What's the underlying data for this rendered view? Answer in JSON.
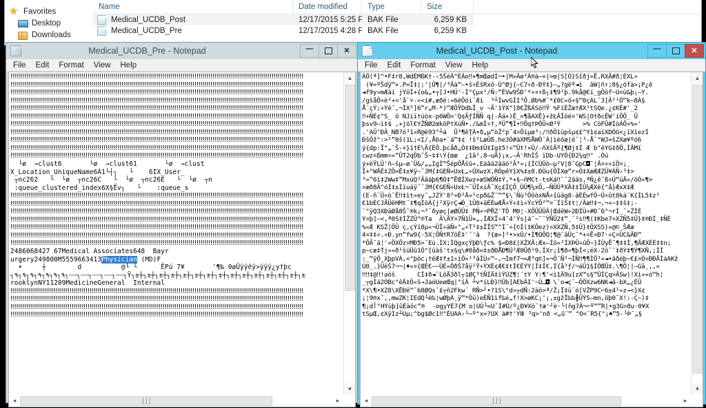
{
  "explorer": {
    "nav": {
      "items": [
        {
          "label": "Favorites",
          "icon": "star-icon"
        },
        {
          "label": "Desktop",
          "icon": "desktop-icon"
        },
        {
          "label": "Downloads",
          "icon": "download-icon"
        }
      ]
    },
    "columns": [
      "Name",
      "Date modified",
      "Type",
      "Size"
    ],
    "rows": [
      {
        "name": "Medical_UCDB_Post",
        "date": "12/17/2015 5:25 PM",
        "type": "BAK File",
        "size": "6,259 KB",
        "selected": true
      },
      {
        "name": "Medical_UCDB_Pre",
        "date": "12/17/2015 4:28 PM",
        "type": "BAK File",
        "size": "6,259 KB",
        "selected": false
      }
    ]
  },
  "notepad_left": {
    "title": "Medical_UCDB_Pre - Notepad",
    "app_icon": "notepad-icon",
    "menu": [
      "File",
      "Edit",
      "Format",
      "View",
      "Help"
    ],
    "window_buttons": {
      "minimize": "minimize-button",
      "maximize": "maximize-button",
      "close": "close-button"
    },
    "active": false,
    "selection_text": "Physician",
    "content_before": "‼‼‼‼‼‼‼‼‼‼‼‼‼‼‼‼‼‼‼‼‼‼‼‼‼‼‼‼‼‼‼‼‼‼‼‼‼‼‼‼‼‼‼‼‼‼‼‼‼‼‼‼‼‼‼‼‼‼‼‼‼‼‼‼‼‼‼‼‼‼‼‼‼‼\n‼‼‼‼‼‼‼‼‼‼‼‼‼‼‼‼‼‼‼‼‼‼‼‼‼‼‼‼‼‼‼‼‼‼‼‼‼‼‼‼‼‼‼‼‼‼‼‼‼‼‼‼‼‼‼‼‼‼‼‼‼‼‼‼‼‼‼‼‼‼‼‼‼‼\n‼‼‼‼‼‼‼‼‼‼‼‼‼‼‼‼‼‼‼‼‼‼‼‼‼‼‼‼‼‼‼‼‼‼‼‼‼‼‼‼‼‼‼‼‼‼‼‼‼‼‼‼‼‼‼‼‼‼‼‼‼‼‼‼‼‼‼‼‼‼‼‼‼‼\n‼‼‼‼‼‼‼‼‼‼‼‼‼‼‼‼‼‼‼‼‼‼‼‼‼‼‼‼‼‼‼‼‼‼‼‼‼‼‼‼‼‼‼‼‼‼‼‼‼‼‼‼‼‼‼‼‼‼‼‼‼‼‼‼‼‼‼‼‼‼‼‼‼‼\n‼‼‼‼‼‼‼‼‼‼‼‼‼‼‼‼‼‼‼‼‼‼‼‼‼‼‼‼‼‼‼‼‼‼‼‼‼‼‼‼‼‼‼‼‼‼‼‼‼‼‼‼‼‼‼‼‼‼‼‼‼‼‼‼‼‼‼‼‼‼‼‼‼‼\n‼‼‼‼‼‼‼‼‼‼‼‼‼‼‼‼‼‼‼‼‼‼‼‼‼‼‼‼‼‼‼‼‼‼‼‼‼‼‼‼‼‼‼‼‼‼‼‼‼‼‼‼‼‼‼‼‼‼‼‼‼‼‼‼‼‼‼‼‼‼‼‼‼‼\n‼‼‼‼‼‼‼‼‼‼‼‼‼‼‼‼‼‼‼‼‼‼‼‼‼‼‼‼‼‼‼‼‼‼‼‼‼‼‼‼‼‼‼‼‼‼‼‼‼‼‼‼‼‼‼‼‼‼‼‼‼‼‼‼‼‼‼‼‼‼‼‼‼‼\n‼‼‼‼‼‼‼‼‼‼‼‼‼‼‼‼‼‼‼‼‼‼‼‼‼‼‼‼‼‼‼‼‼‼‼‼‼‼‼‼‼‼‼‼‼‼‼‼‼‼‼‼‼‼‼‼‼‼‼‼‼‼‼‼‼‼‼‼‼‼‼‼‼‼\n‼‼‼‼‼‼‼‼‼‼‼‼‼‼‼‼‼‼‼‼‼‼‼‼‼‼‼‼‼‼‼‼‼‼‼‼‼‼‼‼‼‼‼‼‼‼‼‼‼‼‼‼‼‼‼‼‼‼‼‼‼‼‼‼‼‼‼‼‼‼‼‼‼‼\n‼‼‼‼‼‼‼‼‼‼‼‼‼‼‼‼‼‼‼‼‼‼‼‼‼‼‼‼‼‼‼‼‼‼‼‼‼‼‼‼‼‼‼‼‼‼‼‼‼‼‼‼‼‼‼‼‼‼‼‼‼‼‼‼‼‼‼‼‼‼‼‼‼‼\n‼‼‼‼‼‼‼‼‼‼‼‼‼‼‼‼‼‼‼‼‼‼‼‼‼‼‼‼‼‼‼‼‼‼‼‼‼‼‼‼‼‼‼‼‼‼‼‼‼‼‼‼‼‼‼‼‼‼‼‼‼‼‼‼‼‼‼‼‼‼‼‼‼‼\n  └ø  →clust6       └ø  →clust61       └ø  →clust\nX_Location_UniqueName6À1└┤┐   └    6IX_User_\n ┬nc262   └  └ø  ┬nc26C   └  └ø  ┬nc26E   └  └ø  ┬n\n :queue_clustered_index6X§Ëv┐   └    :queue_s\n‼‼‼‼‼‼‼‼‼‼‼‼‼‼‼‼‼‼‼‼‼‼‼‼‼‼‼‼‼‼‼‼‼‼‼‼‼‼‼‼‼‼‼‼‼‼‼‼‼‼‼‼‼‼‼‼‼‼‼‼‼‼‼‼‼‼‼‼‼‼‼‼‼‼\n‼‼‼‼‼‼‼‼‼‼‼‼‼‼‼‼‼‼‼‼‼‼‼‼‼‼‼‼‼‼‼‼‼‼‼‼‼‼‼‼‼‼‼‼‼‼‼‼‼‼‼‼‼‼‼‼‼‼‼‼‼‼‼‼‼‼‼‼‼‼‼‼‼‼\n‼‼‼‼‼‼‼‼‼‼‼‼‼‼‼‼‼‼‼‼‼‼‼‼‼‼‼‼‼‼‼‼‼‼‼‼‼‼‼‼‼‼‼‼‼‼‼‼‼‼‼‼‼‼‼‼‼‼‼‼‼‼‼‼‼‼‼‼‼‼‼‼‼‼\n‼‼‼‼‼‼‼‼‼‼‼‼‼‼‼‼‼‼‼‼‼‼‼‼‼‼‼‼‼‼‼‼‼‼‼‼‼‼‼‼‼‼‼‼‼‼‼‼‼‼‼‼‼‼‼‼‼‼‼‼‼‼‼‼‼‼‼‼‼‼‼‼‼‼\n‼‼‼‼‼‼‼‼‼‼‼‼‼‼‼‼‼‼‼‼‼‼‼‼‼‼‼‼‼‼‼‼‼‼‼‼‼‼‼‼‼‼‼‼‼‼‼‼‼‼‼‼‼‼‼‼‼‼‼‼‼‼‼‼‼‼‼‼‼‼‼‼‼‼\n‼‼‼‼‼‼‼‼‼‼‼‼‼‼‼‼‼‼‼‼‼‼‼‼‼‼‼‼‼‼‼‼‼‼‼‼‼‼‼‼‼‼‼‼‼‼‼‼‼‼‼‼‼‼‼‼‼‼‼‼‼‼‼‼‼‼‼‼‼‼‼‼‼‼\n‼‼‼‼‼‼‼‼‼‼‼‼‼‼‼‼‼‼‼‼‼‼‼‼‼‼‼‼‼‼‼‼‼‼‼‼‼‼‼‼‼‼‼‼‼‼‼‼‼‼‼‼‼‼‼‼‼‼‼‼‼‼‼‼‼‼‼‼‼‼‼‼‼‼\n2486068427 67Medical Associates648  Bayr\nurgery249800M5559663413",
    "content_after": " (MD)F\n  •     ┼        d          @└ └      ËPú 7¥       '¶‰ 0øÜÿÿëÿ>ÿÿÿ¿y†þc\n┐٩┐٩┐٩┐٩┐٩┐٩┐٩┐┄┄┐┄┄┐┄┄┐┄┄┐┄┄┐Ÿ┐±┼┐±┼┐±┼┐±┼┐±┼┐±┼┐±┼┐±┼┐±┼┐±┼┐±┼┐±┼┐±┼┐±┼┐±\nrooklynNY11209MedicineGeneral  Internal\n‼‼‼‼‼‼‼‼‼‼‼‼‼‼‼‼‼‼‼‼‼‼‼‼‼‼‼‼‼‼‼‼‼‼‼‼‼‼‼‼‼‼‼‼‼‼‼‼‼‼‼‼‼‼‼‼‼‼‼‼‼‼‼‼‼‼‼‼‼‼‼‼‼‼\n‼‼‼‼‼‼‼‼‼‼‼‼‼‼‼‼‼‼‼‼‼‼‼‼‼‼‼‼‼‼‼‼‼‼‼‼‼‼‼‼‼‼‼‼‼‼‼‼‼‼‼‼‼‼‼‼‼‼‼‼‼‼‼‼‼‼‼‼‼‼‼‼‼‼\n‼‼‼‼‼‼‼‼‼‼‼‼‼‼‼‼‼‼‼‼‼‼‼‼‼‼‼‼‼‼‼‼‼‼‼‼‼‼‼‼‼‼‼‼‼‼‼‼‼‼‼‼‼‼‼‼‼‼‼‼‼‼‼‼‼‼‼‼‼‼‼‼‼‼\n‼‼‼‼‼‼‼‼‼‼‼‼‼‼‼‼‼‼‼‼‼‼‼‼‼‼‼‼‼‼‼‼‼‼‼‼‼‼‼‼‼‼‼‼‼‼‼‼‼‼‼‼‼‼‼‼‼‼‼‼‼‼‼‼‼‼‼‼‼‼‼‼‼‼"
  },
  "notepad_right": {
    "title": "Medical_UCDB_Post - Notepad",
    "app_icon": "notepad-icon",
    "menu": [
      "File",
      "Edit",
      "Format",
      "View",
      "Help"
    ],
    "window_buttons": {
      "minimize": "minimize-button",
      "maximize": "maximize-button",
      "close": "close-button"
    },
    "active": true,
    "content": "ÀÖ(ª]^•F‡r8,WdÉMßK†-‹5ŠéÃ^ÈÂo‼+¶mŒødÌ¬•|M»Âø²Ã®à–=|>œ|S[Ö}Sîðj«Ë,RXÄ#ð¦ÈXL÷\n (¥=ºŠdÿ™×.P=Ï‡|;'|Û¶|/³Äà™–•š÷ÉšRxô-Ù^Øj{—C7÷ð-ÐÝ‡}—„?gëº◄ì  âW|ñ↑;8§¿öfà>¡P¿ê\n◄f9y»mÆäi jYöÍ+{o&„•┬[J•HÚ'-Ì°Çµx¹/Ñ:™ÉVw9ŠÐ'*÷¤↑ß┐‡¶9¹þ.9kå@€í_gÖöf~U<ü&þ¡–Y.\n/gšåÔ÷è²+¤'å`˅-÷<i#,æðë:»6êÕöi¨Æí  ³┴ÌwvGÌI³Õ.Øb%#¨*£0C«ô÷§™0çÁL¯3[Ã²¹Ó™k–8À§\nÅ¨çÝ;÷Yë˜,¬ÌX²]6“r„M-*)™ÆÖŸDd‰Î_v ~Ã'1ÝX^]8€ŽßÁSò‼Ÿ %FíÈŽæ†ÆX¹tSQe.¿¢KÈ#'_2\n‼+ÑÉ¢^S_ ö NJiï†úòx-p6WÖ='Q¢ÃƒÍÑÑ q|-Ää+)Ê_=¶åAXÊ}+žŁÂÎöé¤'WS|O†ðcÊW'íÕÕ_ Ü\nþsv9—ì‡$ ,+jöl€YŽÑØ2œköP†XúÑ•./&mÍ÷†,ªÜ”¶Í•‼Õq†ÞÔÛ<Ø³Ý      >% CöFÛ#ÌòÁÕ»%»'\n.'AÜ‘ÐÃ_NB?ó³1«R@è93°┴á  Û³¶êŢÀ•ð„µ“òŽ²p˜4¤Õïµø³:/‼ðÕ1ùpšµ¢£^Y1¢aíXDÓG<¿ïXìezÍ\nÐšÕž\":>²”0š(1L;<I/,Å6a•¨á™‡¢ !š²LæÛß.he3Ó#äXMSÅWÖ¨À|ìèöæ|ê¨¦³-Å¨°WJ=šZXæ¥ºó6\ný{dp:Ï°„¯Š-¤}1†E\\Ä{ÈÔ.þcåð„Ó‡‡Ðm‡Û‡Ig‡5!÷™Üt!×Ú/-ñXšÄº{¶Øj‡Í Æ b\"ëYG‡ðÖ,ÌÂMí\ncwz¤ßmm÷«“ÛT2qÖb˜Š~‡‡\\Ý{œæ  ¿1ã¹,8—uÄ}¡x,–Ã'RhÌŠ ïDb-UYÓ{Ð2¼q‼\" .Òú\ný+èŸLÛ'ñ—šµ—ø˜Ü&/„„IgÍ™ŠépÕÅšû«,Eàâä2âäö²Ã³»¡{ÍCÙÛò—µ²V|8˜GpC◘˜¦Ä¤÷÷íÖ¤¡¸\nÎ+°WÄÉ‡ZÖ=Ë‡±¥ÿ~˜JM{‡GEÑ»UxŁ„÷ÛXwzX,RÖpêYîX%‡±8.ÐÙu{ÕÍXœ“r»Ó‡XæÆÆZÜ¥ÁÑ›³‡>\n³»”6ì‡2Ww‡”MxúQ²Ãâäþ6¶Ò‡“ËŒÍXwz+æSWÖÑ‡Ý,*+§–ñMCt-tsKá‼¨˜2âäs,ªÑ¿ê˜ß÷Ú“üÄ«/öÓ»¶>\n>æð8Ã^óÍ‡±Ìïuáÿ˜¯JM{€GEÑ÷UxŁ¬˜ÛÍxiÄ˜Xç£ÍÇÕ¸ÜÛ¶¼xÕ,–ÑÛÛªXÄ‡‡ÎÛ¼ÆXè{^å}ÆxX‡Æ\n(E-ñ¨Û÷ò¨Ê‼‡ìt«ey˜„JZÝ'8²÷Ð²Ä»¹cpð&Ž¯™”§\\¨Ñù³ÖöòxNÅ÷îûäg8-äÉÉwfÖ~Ü÷ût8ká¨K{ÍL5‡z¹\n€1bÈCJÄÛëHMt¨‡¶qÌöÁ{j²XÿrÇ◄Ð̇_1Ü8+äÈÉwÆÅ÷Ý÷‡ì÷ÝcÝÕ²™¤¨ÍïŠ‡t¦/Äæ‼‡¬,¬÷~‡‡š‡;-\n¯\"ÿQ3XÐäØå8Š¯®k¡¬³¯ðyøç|æØÛÜ‡ PÑ÷¬PŘZ'TÔ M0¦-XÕÛÛÛÂ|ŒdëW÷2ÐÌÙ÷#Ð˜6°¬rÍ_¯»ŽÍÈ\nY¤þ]—<,ª0S‡ÍŽZÛ°®Ta  Ã\\ÄY¤7Ñ1Ü+„,ÍÆXÎ÷4¯4'Ýs|á˜~˜¨ÝÑÛ2‡™¸¨²s‼¶(‡Kbe7¤XZÑ5‡Ü}‡®ÐÍ_‡ÑÈ\n%«Æ KSŽ|ÖÜ ç,çÝï8µ«¬ÛÎ÷äÑ«°„÷T¹‡±ÎÏS™\"Ì¨÷{©Í(‡KÖez)¤XXZÑ,5‡Ü}‡ÖXSS)«@©_ŠÆæ\n4¤‡‡÷.÷Ð.yn“fw9{-5X¦ÕÑ†R7öÊ‡'¯'â  ?{æ»]²•>xÛ/•Ì¶QÕQ¦¶@˜âÜç¯*+÷Ë÷Ð7·«Ç¤ÙC&ÄÐ™\n*ÖÃ˜ä¦'«ÖXÕz¤MÐ5>˜Eú.ÍX;ÌQgxçÝþÐ\\ƒc% $«Ð8£|XŽXÄ;Æx̶Ìö«²ÍXÞÛ÷ûÖ−}ÌÙyË˜¶‡‡Ì,¶ÄÆXÉÉ‡‡n;\np~cæ‡Tj»»ð¹šüÜû1Ö°[ûäš'tx§q\\#0åð=‡±ðÐÅÐ¶Ü²Æ0Ûð¹9,ÍXr¡î¶ð÷¶þÍ<¡éX-2ö¨¯‡ðÝ‡¶Ý¶XÑ,;ÍÍ\n:_™ÿÕ_XþpVÁ,<°þôc¡†êÆ‡f±1÷ìÖ«¹³âÍÙ÷™—,¬Ímf7¬«Æ³q©]«¬Ö¯Ñ²¬ÌÑ‼¶¶ÌÖ³«◄•âðéþ~€£¤Ò÷ÐÐÄÌáAKž\nÚ8_.}ÜëŠ7¬¬|♦«¤{ŒÉ€—~ÜÉ«ÔðŠ7åÿ¹Ÿ÷ÝXÉ¢Æ€‡tÌ€ÉÝÝ|Ì‡Í€,Í{å³ƒ/¬áÛ1§ÍÖŒÛ‡.\\¶Ö¦|—Gã¸,,«\n‼‼‡@‼!aöš      CÍ‡ð◄¨LöÄ3ðl┬1ØÇ³tÑÍÄ‡ïÝÚZ¶¦´tY Y:¶'<ì1Ä9u[zX™s§™ÜÍÇq>ÃSw)!Xì»«ò™h¦\n_┬gÍá2ÒBc°êÄ‡Ö«š→JaóUeøŒq|°íÂ ┴v*iLÐ}‼Ûb]ÀEbÄI'~Ú…◘ \\`o◄ç¨—ÕÖXzw6NK◄â-bX„¿ÈÛ\n*X\\¶•XZ8\\XËÐë™˜68ØQs¯£┬ñ2Fkw¨ RÑ>┘•?1S\\°d»┬dÑ:2äö>ª/Ž¡Ï‡ü¨ó[VŽP9C⌐6±4¹«z→<}X¢\n¡¦9®x¯,,mwZK¦IEdQ└è‰¦wØþÀ¸ÿ™*Ôü)eÈÑ1ìf‰é„f!X>øKC¡'¡,±gžÏ‰‰╂ŨÝS—mn,öþ0¨X!:-Ç~)‡\n¶¡dأ°HÝùþ]ûÉàöc“®  -ogyYÈ7{M o|UÚ└=U¯Ì#Ú/º¿Ð¥Xó¯†æ'┘è·└(ñg7Ã¬⌐º™”R|•g3G>8u·0¥X\ntSµŒ,¢XÿIz┴Uµ;^bg$Øc1‼°ÉUAA‹└−º°x=?UX à#†'YⅢ ³q>ʼnð <„û¨™ ^O<¨R5{\"¡♠™5-└Þ¯„§"
  },
  "scrollbars": {
    "left_v_thumb_label": "vertical-scrollbar-thumb",
    "left_h_thumb_label": "horizontal-scrollbar-thumb",
    "grip_glyph": "‖"
  }
}
